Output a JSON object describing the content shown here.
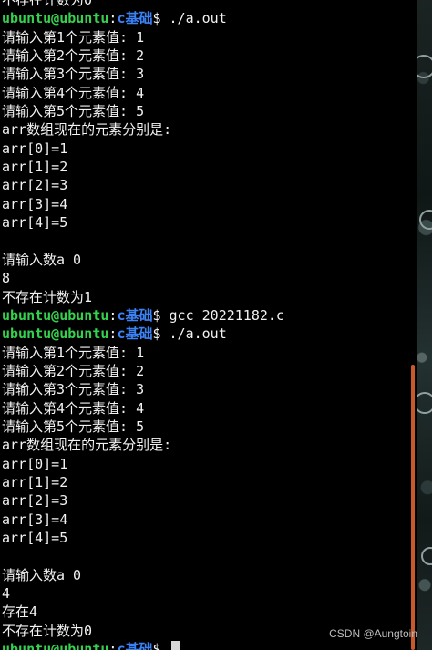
{
  "prompt": {
    "user": "ubuntu@ubuntu",
    "sep": ":",
    "path": "c基础",
    "sign": "$ "
  },
  "lines": [
    {
      "type": "text",
      "text": "不存在计数为0"
    },
    {
      "type": "prompt",
      "cmd": "./a.out"
    },
    {
      "type": "text",
      "text": "请输入第1个元素值: 1"
    },
    {
      "type": "text",
      "text": "请输入第2个元素值: 2"
    },
    {
      "type": "text",
      "text": "请输入第3个元素值: 3"
    },
    {
      "type": "text",
      "text": "请输入第4个元素值: 4"
    },
    {
      "type": "text",
      "text": "请输入第5个元素值: 5"
    },
    {
      "type": "text",
      "text": "arr数组现在的元素分别是:"
    },
    {
      "type": "text",
      "text": "arr[0]=1"
    },
    {
      "type": "text",
      "text": "arr[1]=2"
    },
    {
      "type": "text",
      "text": "arr[2]=3"
    },
    {
      "type": "text",
      "text": "arr[3]=4"
    },
    {
      "type": "text",
      "text": "arr[4]=5"
    },
    {
      "type": "text",
      "text": ""
    },
    {
      "type": "text",
      "text": "请输入数a 0"
    },
    {
      "type": "text",
      "text": "8"
    },
    {
      "type": "text",
      "text": "不存在计数为1"
    },
    {
      "type": "prompt",
      "cmd": "gcc 20221182.c"
    },
    {
      "type": "prompt",
      "cmd": "./a.out"
    },
    {
      "type": "text",
      "text": "请输入第1个元素值: 1"
    },
    {
      "type": "text",
      "text": "请输入第2个元素值: 2"
    },
    {
      "type": "text",
      "text": "请输入第3个元素值: 3"
    },
    {
      "type": "text",
      "text": "请输入第4个元素值: 4"
    },
    {
      "type": "text",
      "text": "请输入第5个元素值: 5"
    },
    {
      "type": "text",
      "text": "arr数组现在的元素分别是:"
    },
    {
      "type": "text",
      "text": "arr[0]=1"
    },
    {
      "type": "text",
      "text": "arr[1]=2"
    },
    {
      "type": "text",
      "text": "arr[2]=3"
    },
    {
      "type": "text",
      "text": "arr[3]=4"
    },
    {
      "type": "text",
      "text": "arr[4]=5"
    },
    {
      "type": "text",
      "text": ""
    },
    {
      "type": "text",
      "text": "请输入数a 0"
    },
    {
      "type": "text",
      "text": "4"
    },
    {
      "type": "text",
      "text": "存在4"
    },
    {
      "type": "text",
      "text": "不存在计数为0"
    },
    {
      "type": "prompt",
      "cmd": "",
      "cursor": true
    }
  ],
  "watermark": "CSDN @Aungtoin",
  "colors": {
    "user": "#35d04e",
    "path": "#3b82f6",
    "text": "#f2f2f2",
    "scrollbar": "#c85a2a"
  }
}
